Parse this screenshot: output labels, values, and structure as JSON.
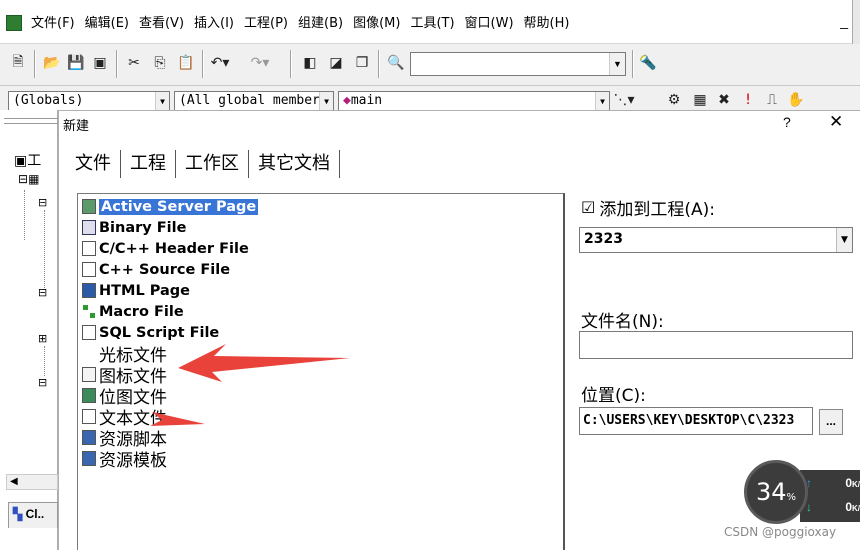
{
  "menubar": {
    "items": [
      "文件(F)",
      "编辑(E)",
      "查看(V)",
      "插入(I)",
      "工程(P)",
      "组建(B)",
      "图像(M)",
      "工具(T)",
      "窗口(W)",
      "帮助(H)"
    ],
    "minimize": "_"
  },
  "toolbar2": {
    "globals": "(Globals)",
    "members": "(All global members",
    "function": "main"
  },
  "workspace": {
    "root_label": "工",
    "tab_label": "Cl.."
  },
  "dialog": {
    "title": "新建",
    "help": "?",
    "close": "✕",
    "tabs": [
      "文件",
      "工程",
      "工作区",
      "其它文档"
    ],
    "file_types": [
      {
        "label": "Active Server Page",
        "icon": "asp-icon",
        "selected": true
      },
      {
        "label": "Binary File",
        "icon": "binary-icon"
      },
      {
        "label": "C/C++ Header File",
        "icon": "header-file-icon"
      },
      {
        "label": "C++ Source File",
        "icon": "source-file-icon"
      },
      {
        "label": "HTML Page",
        "icon": "html-icon"
      },
      {
        "label": "Macro File",
        "icon": "macro-icon"
      },
      {
        "label": "SQL Script File",
        "icon": "sql-icon"
      },
      {
        "label": "光标文件",
        "icon": "cursor-icon"
      },
      {
        "label": "图标文件",
        "icon": "icon-file-icon"
      },
      {
        "label": "位图文件",
        "icon": "bitmap-icon"
      },
      {
        "label": "文本文件",
        "icon": "text-file-icon"
      },
      {
        "label": "资源脚本",
        "icon": "resource-script-icon"
      },
      {
        "label": "资源模板",
        "icon": "resource-template-icon"
      }
    ],
    "add_to_project": {
      "label": "添加到工程(A):",
      "checked": "☑"
    },
    "project_value": "2323",
    "filename_label": "文件名(N):",
    "filename_value": "",
    "location_label": "位置(C):",
    "location_value": "C:\\USERS\\KEY\\DESKTOP\\C\\2323",
    "browse_label": "..."
  },
  "speed_widget": {
    "percent": "34",
    "percent_unit": "%",
    "up": "0",
    "up_unit": "K/",
    "down": "0",
    "down_unit": "K/"
  },
  "watermark": "CSDN @poggioxay",
  "colors": {
    "selection": "#3875d7",
    "annotation_arrow": "#e8423b"
  }
}
